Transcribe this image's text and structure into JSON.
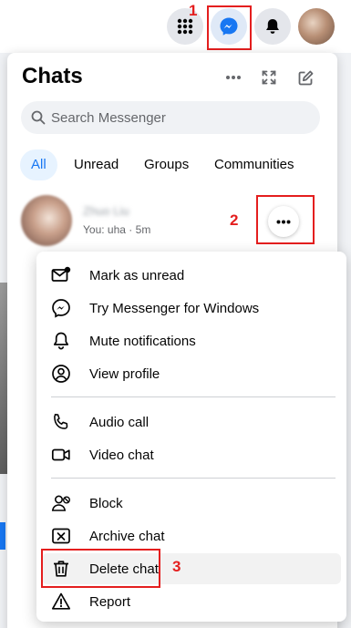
{
  "topbar": {
    "icons": [
      "grid-menu-icon",
      "messenger-icon",
      "bell-icon",
      "profile-avatar"
    ]
  },
  "annotations": [
    "1",
    "2",
    "3"
  ],
  "chats": {
    "title": "Chats",
    "header_icons": [
      "more-icon",
      "expand-icon",
      "new-message-icon"
    ],
    "search_placeholder": "Search Messenger",
    "tabs": [
      "All",
      "Unread",
      "Groups",
      "Communities"
    ],
    "active_tab": "All",
    "conversation": {
      "name": "Zhuo Liu",
      "preview": "You: uha",
      "separator": "·",
      "time": "5m"
    }
  },
  "menu": {
    "items": [
      {
        "label": "Mark as unread",
        "icon": "mark-unread-icon"
      },
      {
        "label": "Try Messenger for Windows",
        "icon": "messenger-icon"
      },
      {
        "label": "Mute notifications",
        "icon": "bell-icon"
      },
      {
        "label": "View profile",
        "icon": "profile-icon"
      },
      {
        "label": "Audio call",
        "icon": "phone-icon"
      },
      {
        "label": "Video chat",
        "icon": "video-icon"
      },
      {
        "label": "Block",
        "icon": "block-user-icon"
      },
      {
        "label": "Archive chat",
        "icon": "archive-icon"
      },
      {
        "label": "Delete chat",
        "icon": "trash-icon"
      },
      {
        "label": "Report",
        "icon": "warning-icon"
      }
    ]
  },
  "colors": {
    "accent": "#1877f2",
    "highlight": "#e41e1e"
  }
}
